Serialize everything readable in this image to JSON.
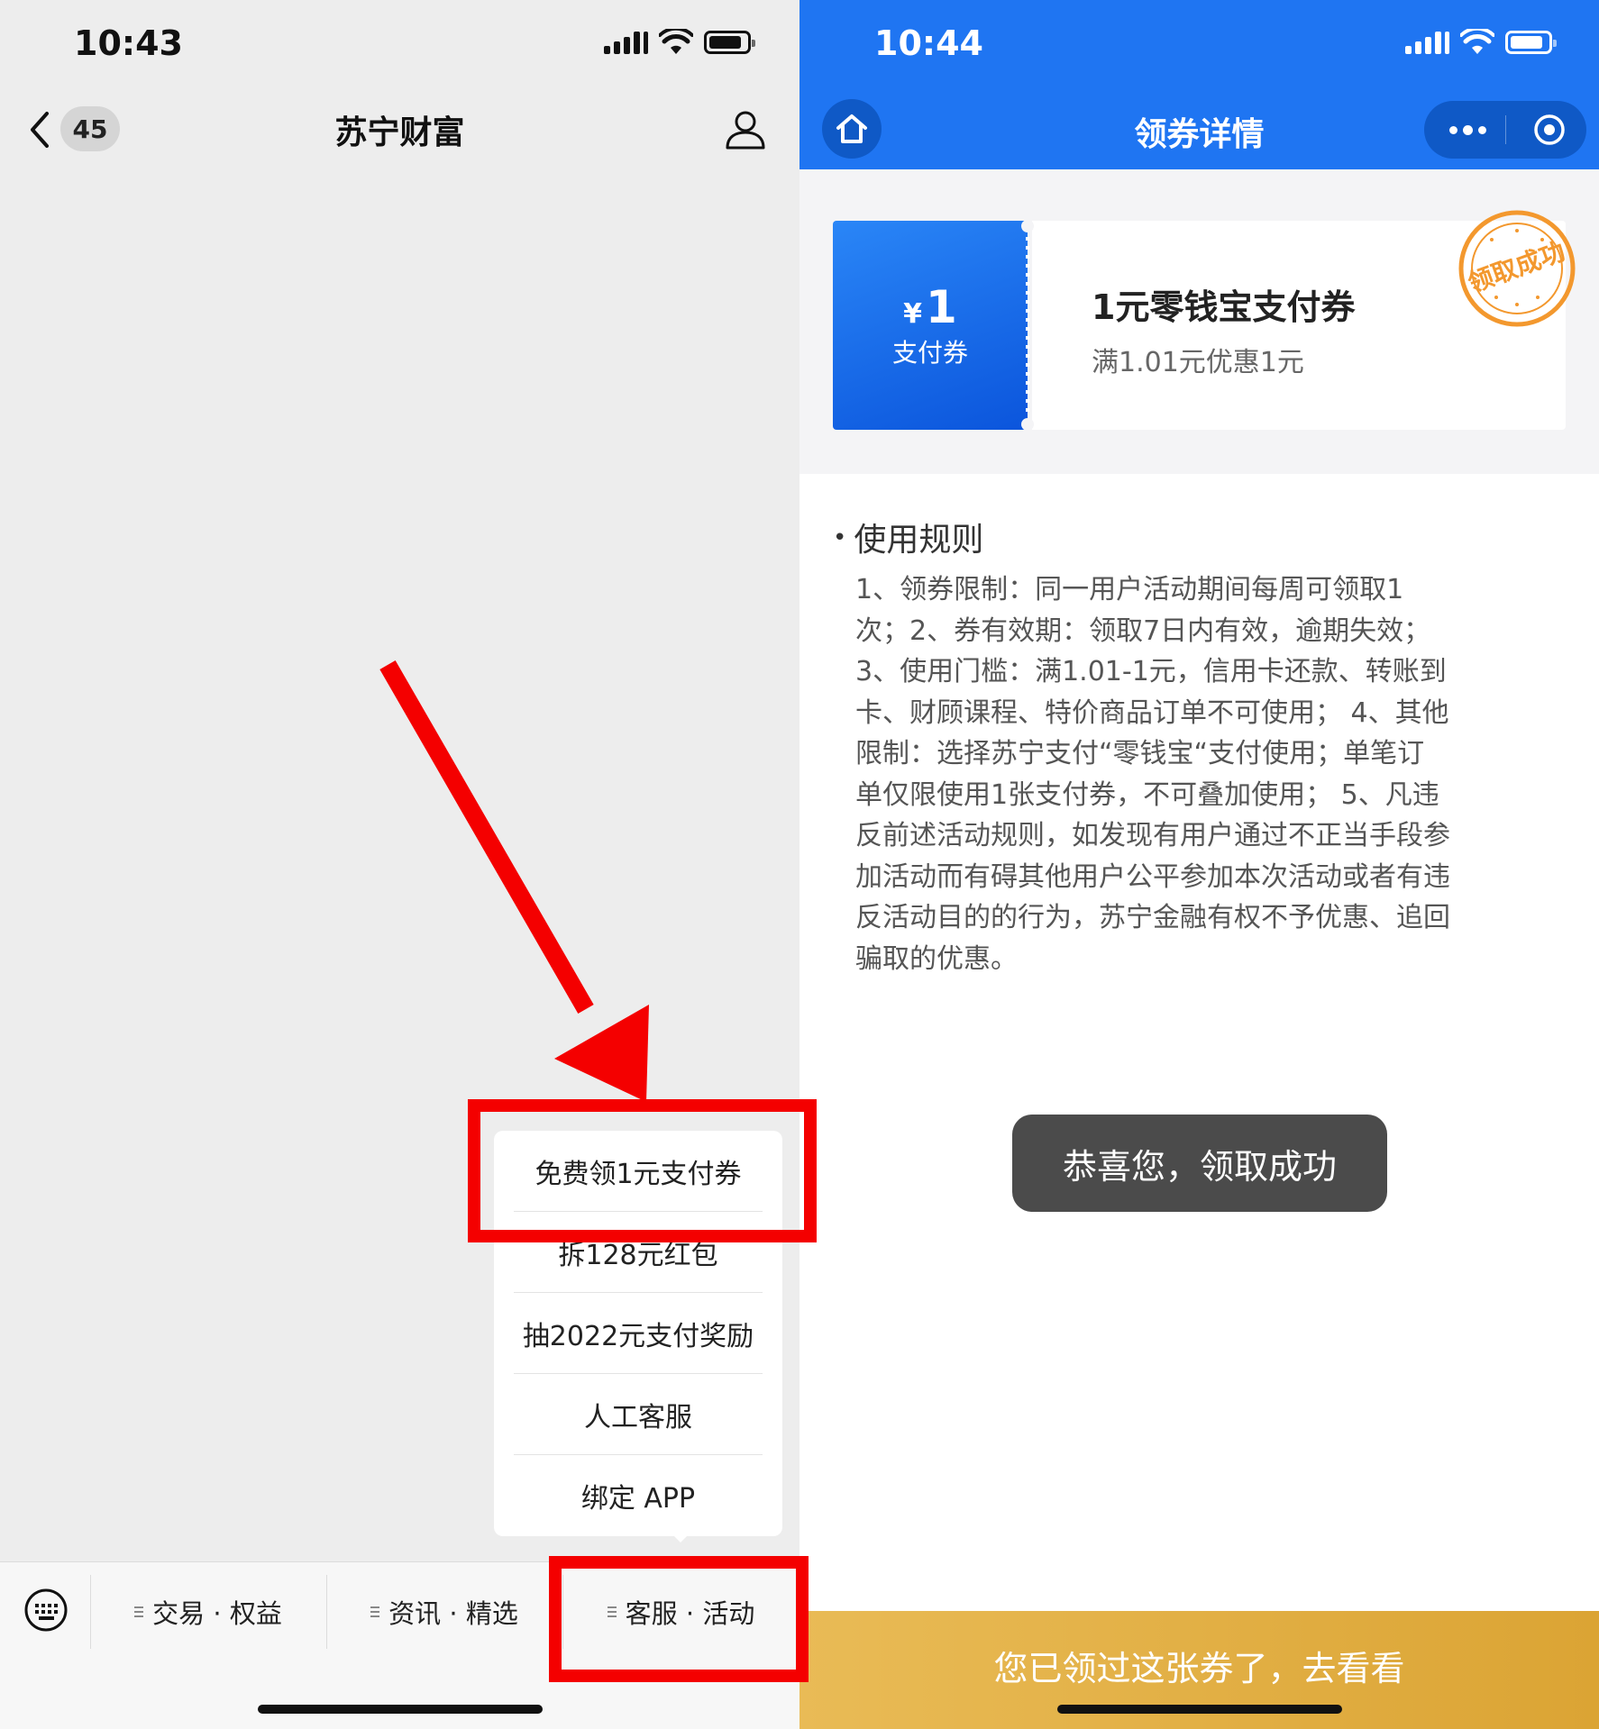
{
  "left": {
    "status_time": "10:43",
    "back_count": "45",
    "title": "苏宁财富",
    "menu_items": [
      "免费领1元支付券",
      "拆128元红包",
      "抽2022元支付奖励",
      "人工客服",
      "绑定 APP"
    ],
    "tabs": [
      "交易 · 权益",
      "资讯 · 精选",
      "客服 · 活动"
    ],
    "annotation_color": "#f40000"
  },
  "right": {
    "status_time": "10:44",
    "title": "领券详情",
    "coupon": {
      "currency": "¥",
      "amount": "1",
      "type": "支付券",
      "title": "1元零钱宝支付券",
      "condition": "满1.01元优惠1元",
      "stamp_text": "领取成功"
    },
    "rules_title": "使用规则",
    "rules_text": "1、领券限制：同一用户活动期间每周可领取1次；2、券有效期：领取7日内有效，逾期失效； 3、使用门槛：满1.01-1元，信用卡还款、转账到卡、财顾课程、特价商品订单不可使用； 4、其他限制：选择苏宁支付“零钱宝“支付使用；单笔订单仅限使用1张支付券，不可叠加使用； 5、凡违反前述活动规则，如发现有用户通过不正当手段参加活动而有碍其他用户公平参加本次活动或者有违反活动目的的行为，苏宁金融有权不予优惠、追回骗取的优惠。",
    "toast": "恭喜您，领取成功",
    "bottom_button": "您已领过这张券了，去看看",
    "accent_color": "#1f75f2"
  }
}
